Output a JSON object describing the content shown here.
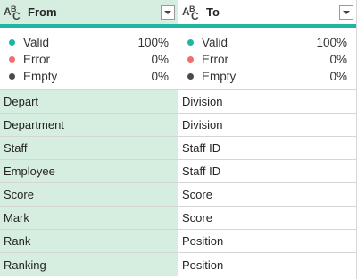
{
  "columns": [
    {
      "name": "From",
      "type_icon": "text-type-icon",
      "stats": [
        {
          "label": "Valid",
          "value": "100%",
          "color": "#1fb5a3"
        },
        {
          "label": "Error",
          "value": "0%",
          "color": "#f26d6d"
        },
        {
          "label": "Empty",
          "value": "0%",
          "color": "#4a4a4a"
        }
      ],
      "rows": [
        "Depart",
        "Department",
        "Staff",
        "Employee",
        "Score",
        "Mark",
        "Rank",
        "Ranking"
      ]
    },
    {
      "name": "To",
      "type_icon": "text-type-icon",
      "stats": [
        {
          "label": "Valid",
          "value": "100%",
          "color": "#1fb5a3"
        },
        {
          "label": "Error",
          "value": "0%",
          "color": "#f26d6d"
        },
        {
          "label": "Empty",
          "value": "0%",
          "color": "#4a4a4a"
        }
      ],
      "rows": [
        "Division",
        "Division",
        "Staff ID",
        "Staff ID",
        "Score",
        "Score",
        "Position",
        "Position"
      ]
    }
  ],
  "type_glyphs": {
    "a": "A",
    "b": "B",
    "c": "C"
  },
  "colors": {
    "accent": "#1fb5a3",
    "selected_column_bg": "#d6eedf"
  }
}
